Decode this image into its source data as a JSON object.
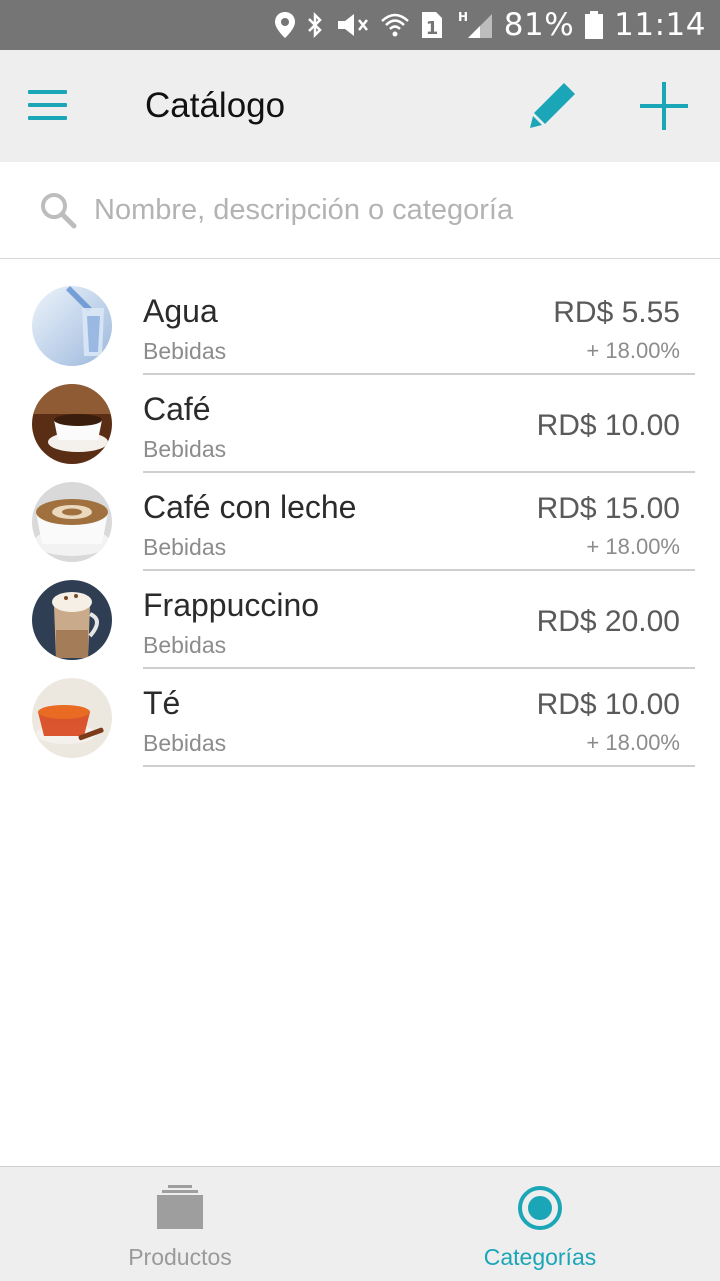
{
  "status_bar": {
    "battery": "81%",
    "time": "11:14",
    "sim_slot": "1",
    "network": "H",
    "icons": [
      "location-icon",
      "bluetooth-icon",
      "mute-icon",
      "wifi-icon",
      "sim-icon",
      "signal-icon",
      "battery-icon"
    ]
  },
  "app_bar": {
    "title": "Catálogo",
    "icons": [
      "menu-icon",
      "pencil-icon",
      "plus-icon"
    ]
  },
  "search": {
    "placeholder": "Nombre, descripción o categoría",
    "value": ""
  },
  "items": [
    {
      "name": "Agua",
      "category": "Bebidas",
      "price": "RD$ 5.55",
      "tax": "+ 18.00%",
      "image": "water-glass"
    },
    {
      "name": "Café",
      "category": "Bebidas",
      "price": "RD$ 10.00",
      "tax": "",
      "image": "coffee-cup"
    },
    {
      "name": "Café con leche",
      "category": "Bebidas",
      "price": "RD$ 15.00",
      "tax": "+ 18.00%",
      "image": "latte"
    },
    {
      "name": "Frappuccino",
      "category": "Bebidas",
      "price": "RD$ 20.00",
      "tax": "",
      "image": "frappuccino"
    },
    {
      "name": "Té",
      "category": "Bebidas",
      "price": "RD$ 10.00",
      "tax": "+ 18.00%",
      "image": "tea-cup"
    }
  ],
  "bottom_nav": {
    "tabs": [
      {
        "label": "Productos",
        "icon": "products-stack-icon",
        "active": false
      },
      {
        "label": "Categorías",
        "icon": "categories-radio-icon",
        "active": true
      }
    ]
  },
  "colors": {
    "accent": "#1aa6b7",
    "status_bar": "#757575",
    "app_bar": "#eeeeee",
    "inactive": "#9a9a9a"
  }
}
